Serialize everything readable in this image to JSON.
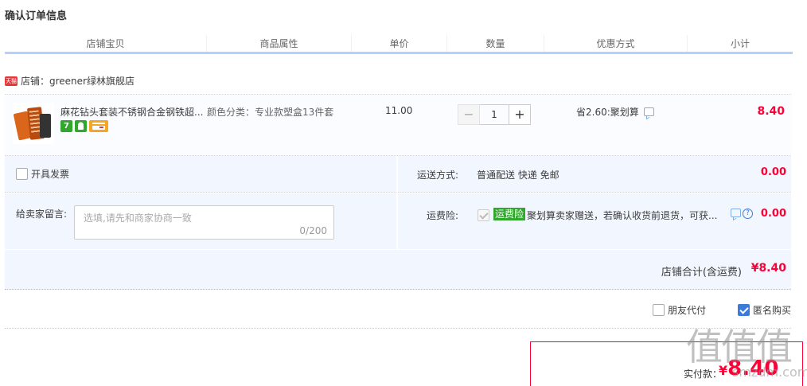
{
  "page": {
    "title": "确认订单信息"
  },
  "columns": [
    "店铺宝贝",
    "商品属性",
    "单价",
    "数量",
    "优惠方式",
    "小计"
  ],
  "shop": {
    "badge": "天猫",
    "label": "店铺：greener绿林旗舰店"
  },
  "item": {
    "title": "麻花钻头套装不锈钢合金钢铁超...",
    "badges": [
      "7",
      "android",
      "card"
    ],
    "attribute": "颜色分类：专业款塑盒13件套",
    "price": "11.00",
    "quantity": "1",
    "qty_minus": "−",
    "qty_plus": "+",
    "discount": "省2.60:聚划算",
    "subtotal": "8.40"
  },
  "invoice": {
    "label": "开具发票"
  },
  "shipping": {
    "label": "运送方式:",
    "value": "普通配送 快递 免邮",
    "price": "0.00"
  },
  "message": {
    "label": "给卖家留言:",
    "placeholder": "选填,请先和商家协商一致",
    "count": "0/200"
  },
  "insurance": {
    "label": "运费险:",
    "tag": "运费险",
    "desc": "聚划算卖家赠送，若确认收货前退货，可获...",
    "help": "?",
    "price": "0.00"
  },
  "shop_total": {
    "label": "店铺合计(含运费)",
    "amount": "¥8.40"
  },
  "options": {
    "friend_pay": "朋友代付",
    "anonymous": "匿名购买"
  },
  "payment": {
    "label": "实付款：",
    "currency": "¥",
    "amount": "8.40"
  },
  "watermark": {
    "logo": "值值值",
    "url": "smzdm.com"
  },
  "colors": {
    "accent": "#ff0036",
    "header_line": "#b2d1ff",
    "panel_bg": "#f2f7ff",
    "checkbox_on": "#3d7bd9",
    "tag_green": "#31a72d"
  }
}
